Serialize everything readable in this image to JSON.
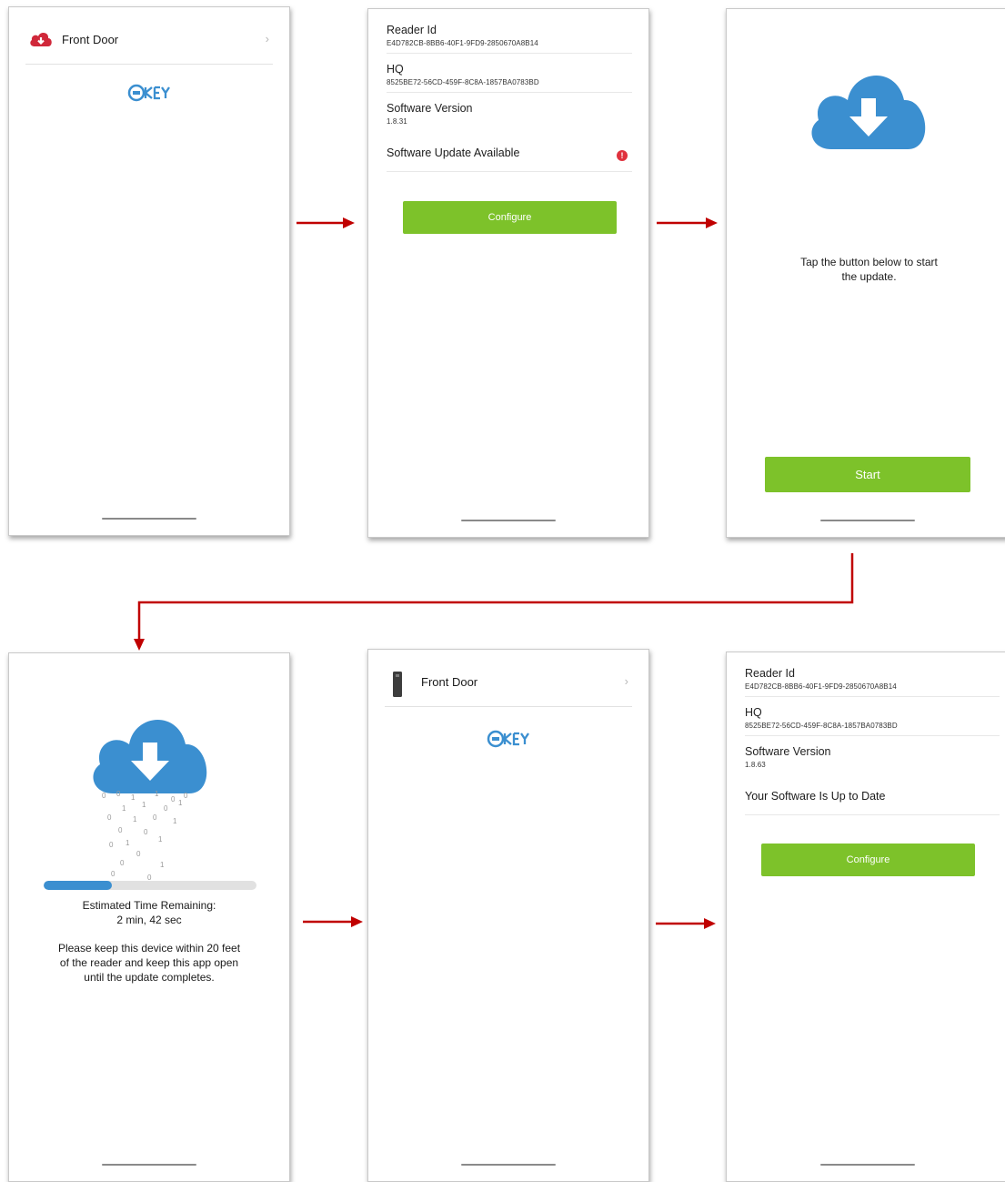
{
  "screen1": {
    "door_label": "Front Door",
    "chevron": "›",
    "icons": [
      "cloud-download-icon",
      "chevron-right-icon",
      "okey-logo"
    ]
  },
  "screen2": {
    "items": [
      {
        "title": "Reader Id",
        "sub": "E4D782CB-8BB6-40F1-9FD9-2850670A8B14"
      },
      {
        "title": "HQ",
        "sub": "8525BE72-56CD-459F-8C8A-1857BA0783BD"
      },
      {
        "title": "Software Version",
        "sub": "1.8.31"
      }
    ],
    "status": "Software Update Available",
    "alert": "!",
    "button": "Configure",
    "accent": "#7dc22a",
    "alert_color": "#e0323e"
  },
  "screen3": {
    "message_line1": "Tap the button below to start",
    "message_line2": "the update.",
    "button": "Start",
    "icon": "cloud-download-icon",
    "cloud_color": "#3b8fd0"
  },
  "screen4": {
    "progress": 0.32,
    "time_label": "Estimated Time Remaining:",
    "time_value": "2 min, 42 sec",
    "notice_line1": "Please keep this device within 20 feet",
    "notice_line2": "of the reader and keep this app open",
    "notice_line3": "until the update completes.",
    "binary_digits": [
      "0",
      "0",
      "1",
      "1",
      "0",
      "0",
      "1",
      "1",
      "0",
      "1",
      "0",
      "1",
      "0",
      "1",
      "0",
      "0",
      "1",
      "1",
      "0",
      "0",
      "0",
      "1",
      "0",
      "0"
    ]
  },
  "screen5": {
    "door_label": "Front Door",
    "chevron": "›",
    "icons": [
      "reader-device-icon",
      "chevron-right-icon",
      "okey-logo"
    ]
  },
  "screen6": {
    "items": [
      {
        "title": "Reader Id",
        "sub": "E4D782CB-8BB6-40F1-9FD9-2850670A8B14"
      },
      {
        "title": "HQ",
        "sub": "8525BE72-56CD-459F-8C8A-1857BA0783BD"
      },
      {
        "title": "Software Version",
        "sub": "1.8.63"
      }
    ],
    "status": "Your Software Is Up to Date",
    "button": "Configure"
  },
  "flow_arrow_color": "#c00000"
}
